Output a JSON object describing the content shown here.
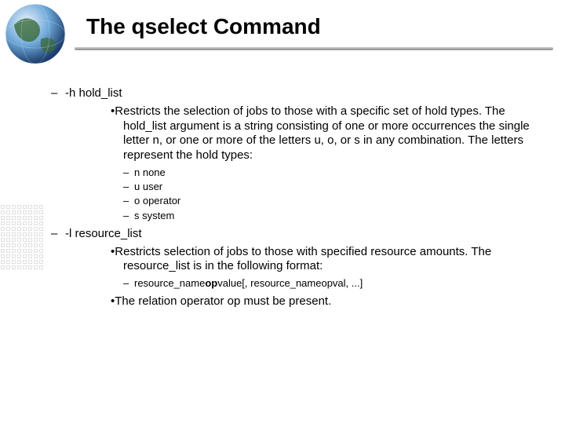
{
  "title": "The qselect Command",
  "sections": [
    {
      "flag": "-h hold_list",
      "bullets": [
        {
          "text": "Restricts the selection of jobs to those with a specific set of hold types. The hold_list argument is a string consisting of one or more occurrences the single letter n, or one or more of the letters u, o, or s in any combination. The letters represent the hold types:",
          "sub": [
            "n none",
            "u user",
            "o operator",
            "s system"
          ]
        }
      ]
    },
    {
      "flag": "-l resource_list",
      "bullets": [
        {
          "text": "Restricts selection of jobs to those with specified resource amounts. The resource_list is in the following format:",
          "format": {
            "p1": "resource_name",
            "op": "op",
            "p2": "value[, resource_nameopval, ...]"
          }
        },
        {
          "text": "The relation operator op must be present."
        }
      ]
    }
  ]
}
